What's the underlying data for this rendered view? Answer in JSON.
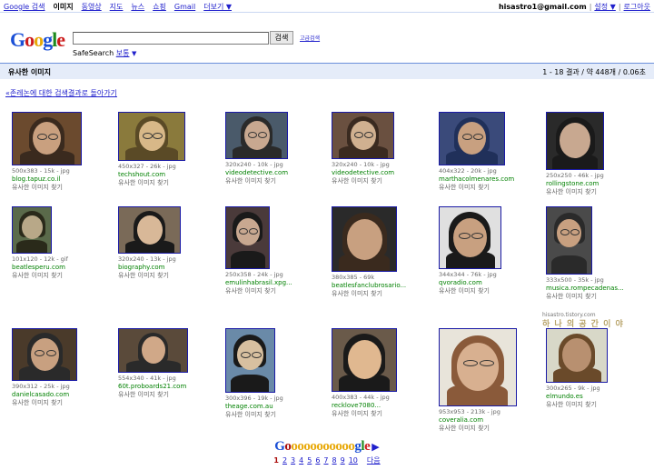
{
  "topnav": {
    "items": [
      {
        "label": "Google 검색",
        "active": false
      },
      {
        "label": "이미지",
        "active": true
      },
      {
        "label": "동영상",
        "active": false
      },
      {
        "label": "지도",
        "active": false
      },
      {
        "label": "뉴스",
        "active": false
      },
      {
        "label": "쇼핑",
        "active": false
      },
      {
        "label": "Gmail",
        "active": false
      },
      {
        "label": "더보기 ▼",
        "active": false
      }
    ],
    "email": "hisastro1@gmail.com",
    "settings": "설정 ▼",
    "logout": "로그아웃"
  },
  "logo": "Google",
  "search": {
    "value": "",
    "button": "검색",
    "advanced": "고급검색"
  },
  "safesearch": {
    "label": "SafeSearch",
    "value": "보통",
    "arrow": "▼"
  },
  "results": {
    "title": "유사한 이미지",
    "stats": "1 - 18 결과 / 약 448개 / 0.06초"
  },
  "back_link": "«존레논에 대한 검색결과로 돌아가기",
  "images": [
    {
      "meta": "500x383 - 15k - jpg",
      "domain": "blog.tapuz.co.il",
      "similar": "유사한 이미지 찾기"
    },
    {
      "meta": "450x327 - 26k - jpg",
      "domain": "techshout.com",
      "similar": "유사한 이미지 찾기"
    },
    {
      "meta": "320x240 - 10k - jpg",
      "domain": "videodetective.com",
      "similar": "유사한 이미지 찾기"
    },
    {
      "meta": "320x240 - 10k - jpg",
      "domain": "videodetective.com",
      "similar": "유사한 이미지 찾기"
    },
    {
      "meta": "404x322 - 20k - jpg",
      "domain": "marthacolmenares.com",
      "similar": "유사한 이미지 찾기"
    },
    {
      "meta": "250x250 - 46k - jpg",
      "domain": "rollingstone.com",
      "similar": "유사한 이미지 찾기"
    },
    {
      "meta": "101x120 - 12k - gif",
      "domain": "beatlesperu.com",
      "similar": "유사한 이미지 찾기"
    },
    {
      "meta": "320x240 - 13k - jpg",
      "domain": "biography.com",
      "similar": "유사한 이미지 찾기"
    },
    {
      "meta": "250x358 - 24k - jpg",
      "domain": "emulinhabrasil.xpg...",
      "similar": "유사한 이미지 찾기"
    },
    {
      "meta": "380x385 - 69k",
      "domain": "beatlesfanclubrosario...",
      "similar": "유사한 이미지 찾기"
    },
    {
      "meta": "344x344 - 76k - jpg",
      "domain": "qvoradio.com",
      "similar": "유사한 이미지 찾기"
    },
    {
      "meta": "333x500 - 35k - jpg",
      "domain": "musica.rompecadenas...",
      "similar": "유사한 이미지 찾기"
    },
    {
      "meta": "390x312 - 25k - jpg",
      "domain": "danielcasado.com",
      "similar": "유사한 이미지 찾기"
    },
    {
      "meta": "554x340 - 41k - jpg",
      "domain": "60t.proboards21.com",
      "similar": "유사한 이미지 찾기"
    },
    {
      "meta": "300x396 - 19k - jpg",
      "domain": "theage.com.au",
      "similar": "유사한 이미지 찾기"
    },
    {
      "meta": "400x383 - 44k - jpg",
      "domain": "recklove7080...",
      "similar": "유사한 이미지 찾기"
    },
    {
      "meta": "953x953 - 213k - jpg",
      "domain": "coveralia.com",
      "similar": "유사한 이미지 찾기"
    },
    {
      "meta": "300x265 - 9k - jpg",
      "domain": "elmundo.es",
      "similar": "유사한 이미지 찾기"
    }
  ],
  "watermark": {
    "site": "hisastro.tistory.com",
    "text": "하 나 의 공 간 이 야"
  },
  "pager": {
    "logo": "Gooooooooooogle",
    "arrow": "▶",
    "pages": [
      "1",
      "2",
      "3",
      "4",
      "5",
      "6",
      "7",
      "8",
      "9",
      "10"
    ],
    "next": "다음"
  },
  "colors": {
    "link": "#2020cc",
    "green_url": "#008000",
    "bar": "#e5ecf9",
    "current_page": "#a90a08"
  }
}
